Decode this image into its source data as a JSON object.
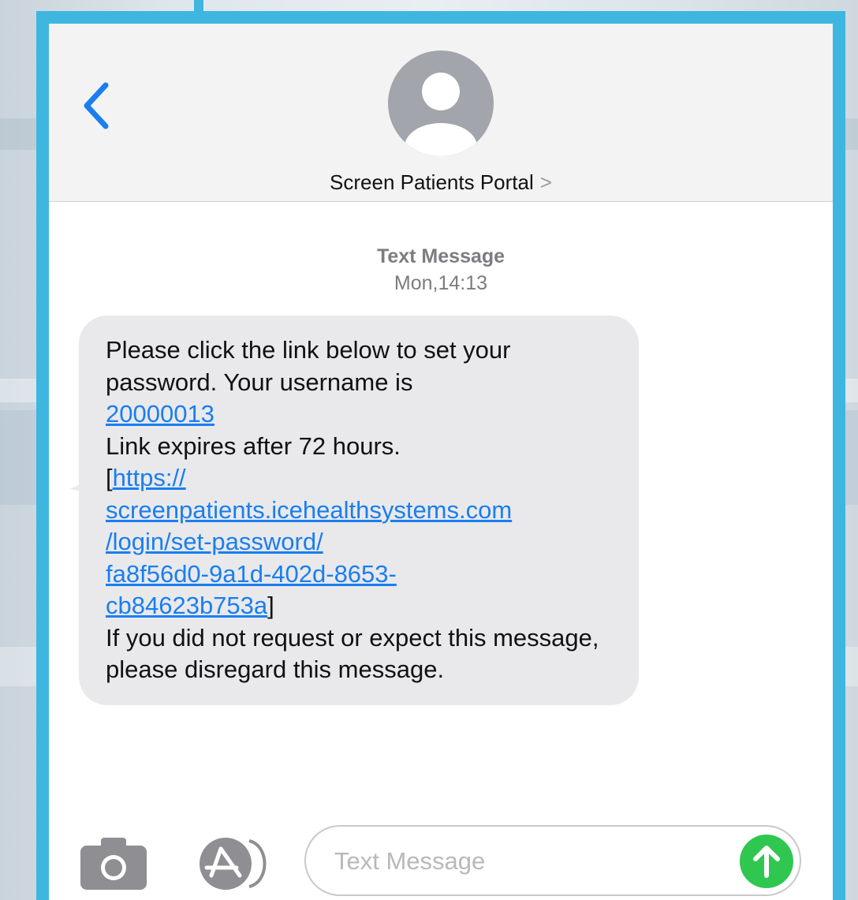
{
  "header": {
    "contact_name": "Screen Patients Portal",
    "contact_chevron": ">"
  },
  "conversation": {
    "kind": "Text Message",
    "timestamp": "Mon,14:13"
  },
  "message": {
    "text1": "Please click the link below to set your password. Your username is",
    "username": "20000013",
    "text2": "Link expires after 72 hours.",
    "bracket_open": "[",
    "link_lines": [
      "https://",
      "screenpatients.icehealthsystems.com",
      "/login/set-password/",
      "fa8f56d0-9a1d-402d-8653-",
      "cb84623b753a"
    ],
    "bracket_close": "]",
    "text3": "If you did not request or expect this message, please disregard this message."
  },
  "input": {
    "placeholder": "Text Message",
    "value": ""
  },
  "colors": {
    "accent": "#1a7ef0",
    "send": "#30c751",
    "frame": "#3fb6e0",
    "bubble": "#e9e9eb"
  },
  "icons": [
    "back-chevron-icon",
    "contact-avatar-icon",
    "camera-icon",
    "app-store-icon",
    "send-arrow-icon"
  ]
}
